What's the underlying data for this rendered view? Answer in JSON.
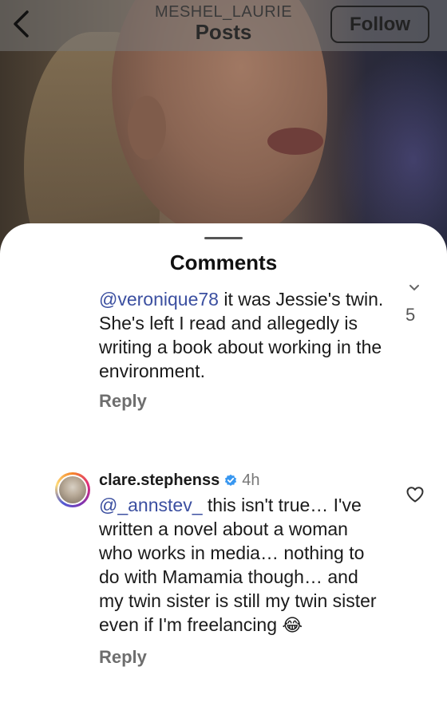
{
  "header": {
    "username": "MESHEL_LAURIE",
    "title": "Posts",
    "follow_label": "Follow"
  },
  "sheet": {
    "title": "Comments"
  },
  "comments": [
    {
      "mention": "@veronique78",
      "text": " it was Jessie's twin. She's left I read and allegedly is writing a book about working in the environment.",
      "likes": "5",
      "reply_label": "Reply"
    },
    {
      "username": "clare.stephenss",
      "verified": true,
      "time": "4h",
      "mention": "@_annstev_",
      "text": "  this isn't true… I've written a novel about a woman who works in media… nothing to do with Mamamia though… and my twin sister is still my twin sister even if I'm freelancing ",
      "emoji": "😂",
      "reply_label": "Reply"
    }
  ],
  "icons": {
    "back": "chevron-left-icon",
    "verified": "verified-badge-icon",
    "heart": "heart-outline-icon",
    "chevron": "chevron-down-icon"
  },
  "colors": {
    "mention": "#3b4fa0",
    "verified": "#3897f0",
    "reply": "#6e6e6e"
  }
}
